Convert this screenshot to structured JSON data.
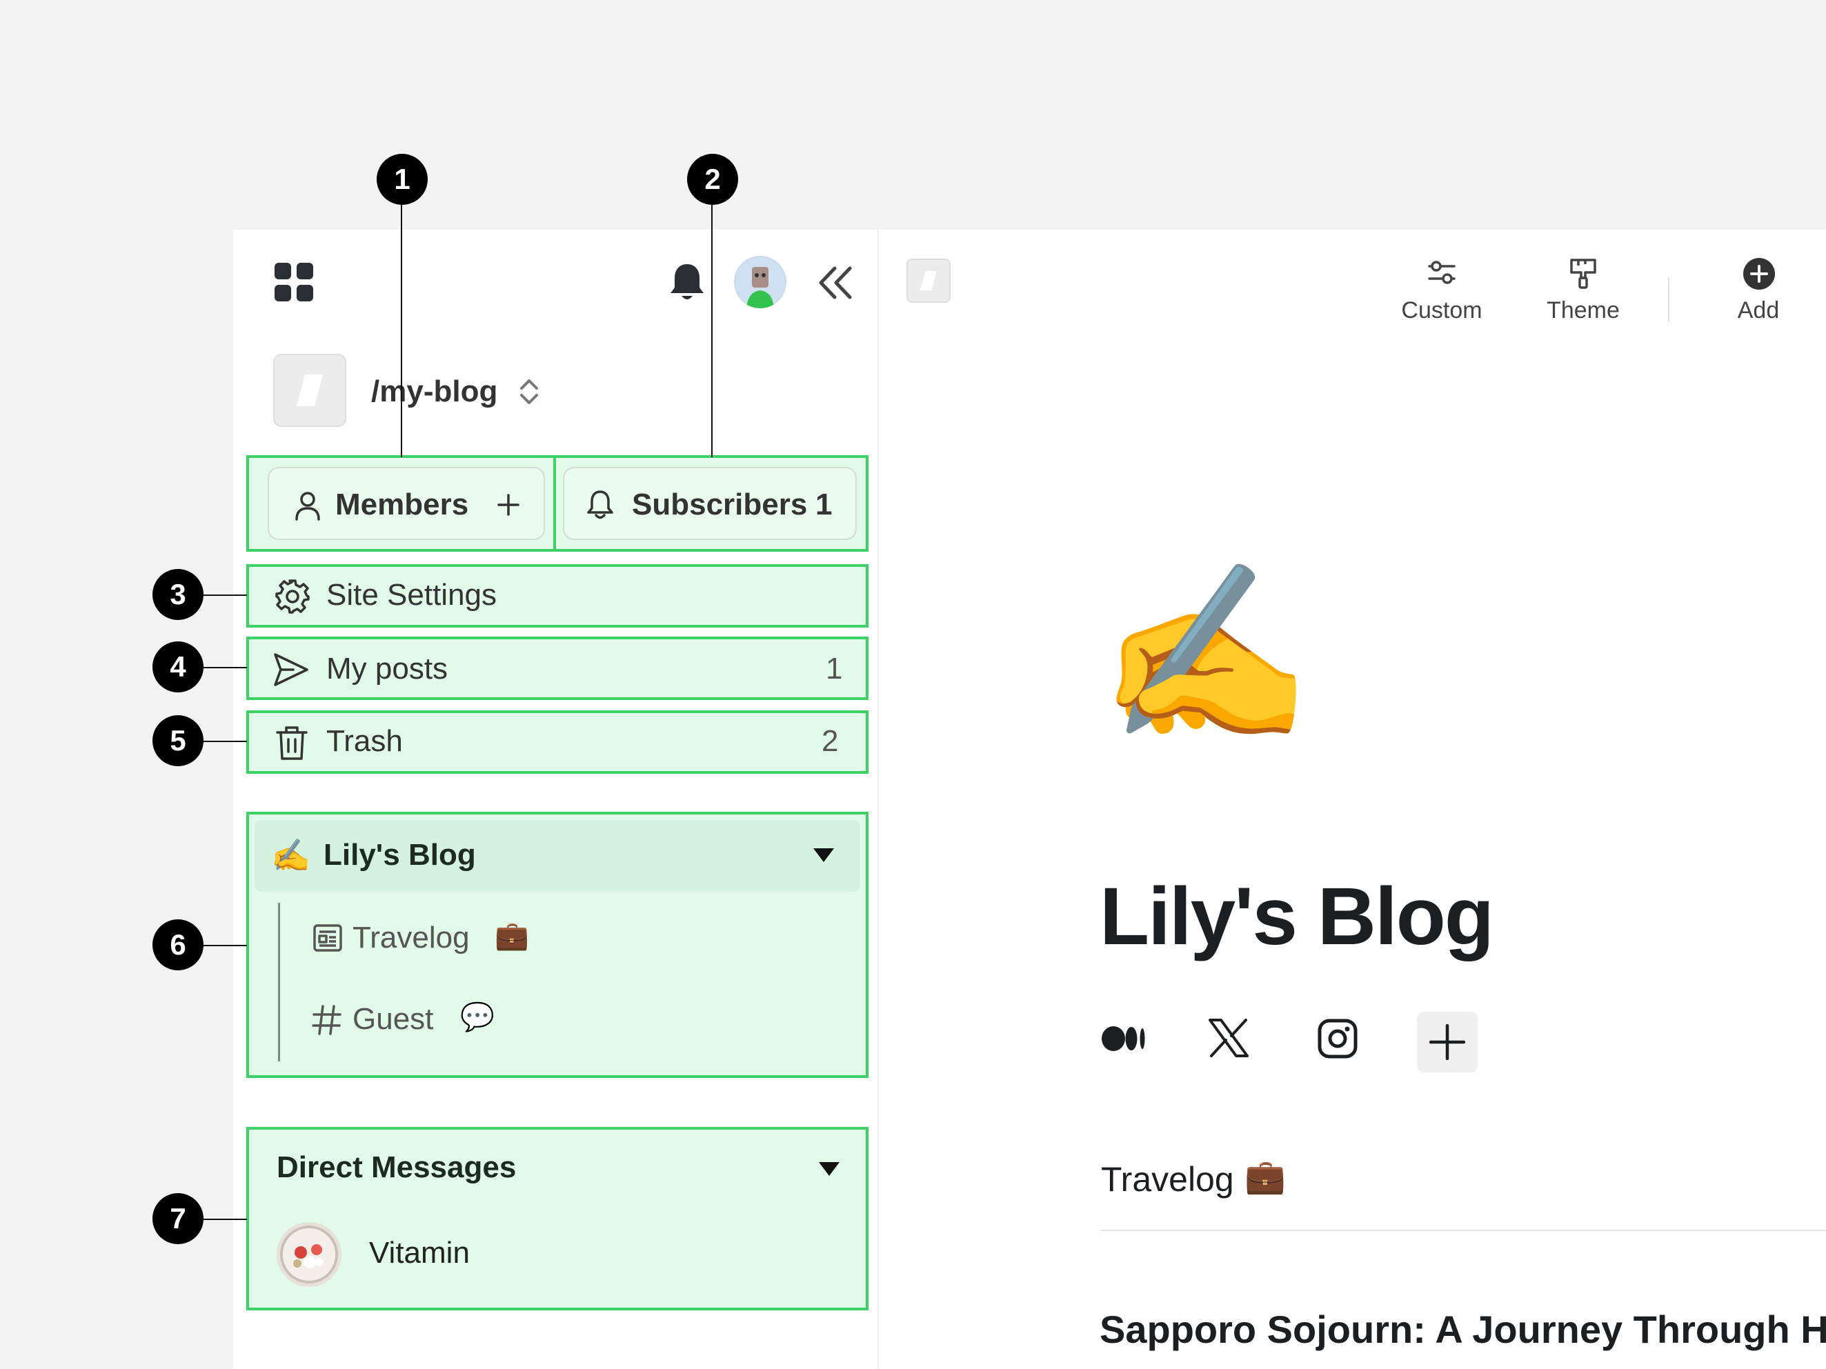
{
  "sidebar": {
    "blog_path": "/my-blog",
    "members_label": "Members",
    "subscribers_label": "Subscribers",
    "subscribers_count": "1",
    "site_settings_label": "Site Settings",
    "my_posts_label": "My posts",
    "my_posts_count": "1",
    "trash_label": "Trash",
    "trash_count": "2",
    "blog_section": {
      "emoji": "✍️",
      "title": "Lily's Blog",
      "channels": [
        {
          "label": "Travelog",
          "emoji": "💼"
        },
        {
          "label": "Guest",
          "emoji": "💬"
        }
      ]
    },
    "dm_section": {
      "title": "Direct Messages",
      "contacts": [
        {
          "name": "Vitamin"
        }
      ]
    }
  },
  "callouts": [
    "1",
    "2",
    "3",
    "4",
    "5",
    "6",
    "7"
  ],
  "toolbar": {
    "custom_label": "Custom",
    "theme_label": "Theme",
    "add_label": "Add"
  },
  "main": {
    "hero_emoji": "✍️",
    "title": "Lily's Blog",
    "social_icons": [
      "medium-icon",
      "x-icon",
      "instagram-icon",
      "add-social-icon"
    ],
    "section_title": "Travelog",
    "section_emoji": "💼",
    "post_title": "Sapporo Sojourn: A Journey Through H"
  },
  "colors": {
    "highlight_fill": "#e2fbe8",
    "highlight_border": "#3dd168",
    "callout": "#000000"
  }
}
